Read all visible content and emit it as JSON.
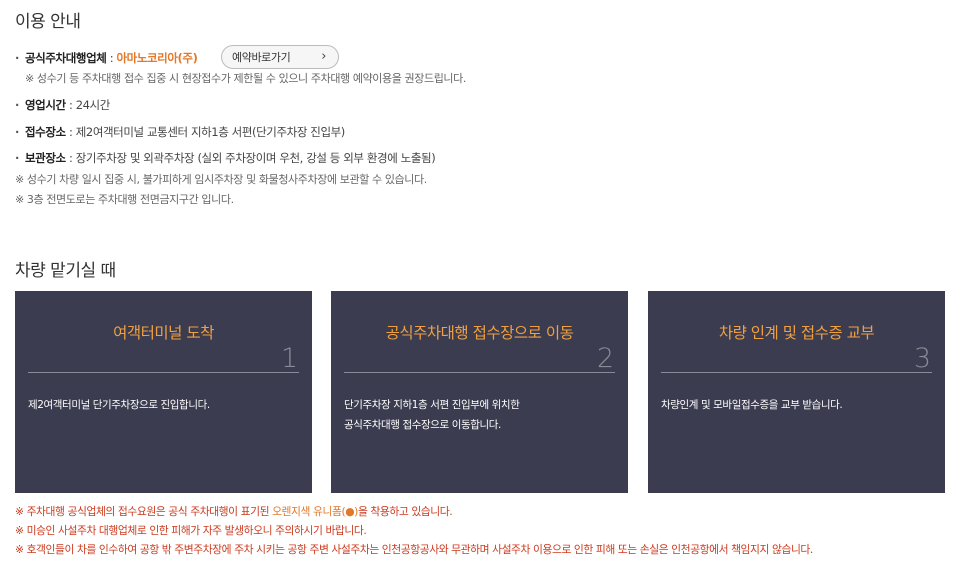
{
  "usage": {
    "title": "이용 안내",
    "operator_label": "공식주차대행업체",
    "operator_sep": " : ",
    "operator_name": "아마노코리아(주)",
    "reserve_button": "예약바로가기",
    "operator_note": "※ 성수기 등 주차대행 접수 집중 시 현장접수가 제한될 수 있으니 주차대행 예약이용을 권장드립니다.",
    "hours_label": "영업시간",
    "hours_value": " : 24시간",
    "place_label": "접수장소",
    "place_value": " : 제2여객터미널 교통센터 지하1층 서편(단기주차장 진입부)",
    "storage_label": "보관장소",
    "storage_value": " : 장기주차장 및 외곽주차장 (실외 주차장이며 우천, 강설 등 외부 환경에 노출됨)",
    "storage_note1": "※ 성수기 차량 일시 집중 시, 불가피하게 임시주차장 및 화물청사주차장에 보관할 수 있습니다.",
    "storage_note2": "※ 3층 전면도로는 주차대행 전면금지구간 입니다."
  },
  "steps": {
    "title": "차량 맡기실 때",
    "cards": [
      {
        "title": "여객터미널 도착",
        "num": "1",
        "desc_line1": "제2여객터미널 단기주차장으로 진입합니다.",
        "desc_line2": ""
      },
      {
        "title": "공식주차대행 접수장으로 이동",
        "num": "2",
        "desc_line1": "단기주차장 지하1층 서편 진입부에 위치한",
        "desc_line2": "공식주차대행 접수장으로 이동합니다."
      },
      {
        "title": "차량 인계 및 접수증 교부",
        "num": "3",
        "desc_line1": "차량인계 및 모바일접수증을 교부 받습니다.",
        "desc_line2": ""
      }
    ]
  },
  "warnings": {
    "w1_a": "※ 주차대행 공식업체의 접수요원은 공식 주차대행이 표기된 ",
    "w1_b": "오렌지색 유니폼(●)",
    "w1_c": "을 착용하고 있습니다.",
    "w2": "※ 미승인 사설주차 대행업체로 인한 피해가 자주 발생하오니 주의하시기 바랍니다.",
    "w3": "※ 호객인들이 차를 인수하여 공항 밖 주변주차장에 주차 시키는 공항 주변 사설주차는 인천공항공사와 무관하며 사설주차 이용으로 인한 피해 또는 손실은 인천공항에서 책임지지 않습니다."
  },
  "colors": {
    "card_bg": "#3b3c50",
    "card_title": "#f0a040",
    "accent_orange": "#e2782c",
    "warning_red": "#cc3b1f"
  }
}
